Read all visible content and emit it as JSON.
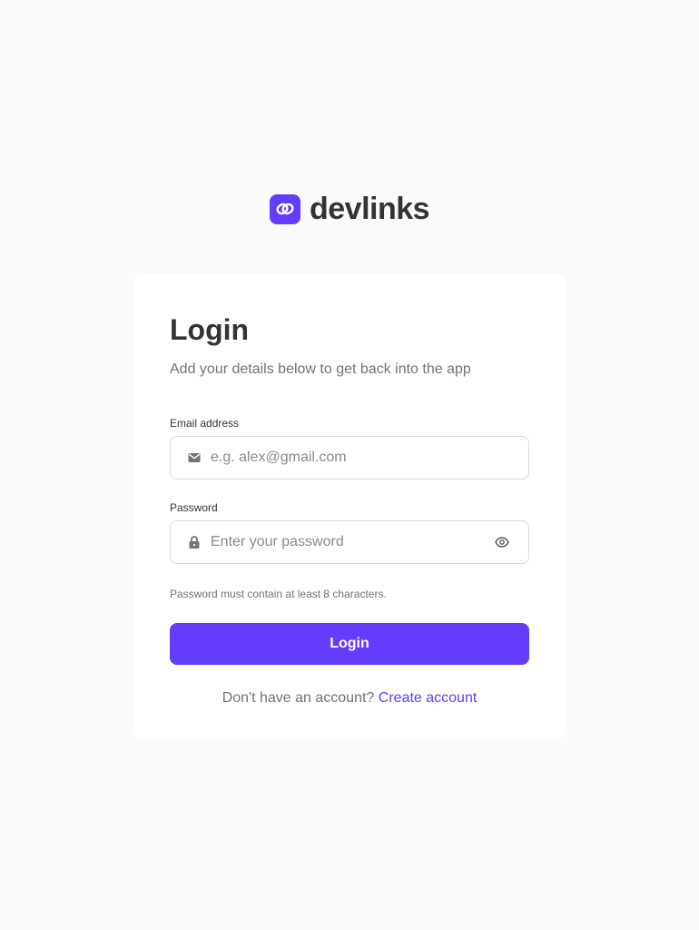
{
  "brand": {
    "name": "devlinks",
    "accent_color": "#633cff",
    "icon": "link-icon"
  },
  "login": {
    "title": "Login",
    "subtitle": "Add your details below to get back into the app",
    "email": {
      "label": "Email address",
      "placeholder": "e.g. alex@gmail.com",
      "value": "",
      "icon": "envelope-icon"
    },
    "password": {
      "label": "Password",
      "placeholder": "Enter your password",
      "value": "",
      "icon": "lock-icon",
      "toggle_icon": "eye-icon"
    },
    "hint": "Password must contain at least 8 characters.",
    "submit_label": "Login",
    "signup_prompt": "Don't have an account?",
    "signup_link": "Create account"
  }
}
